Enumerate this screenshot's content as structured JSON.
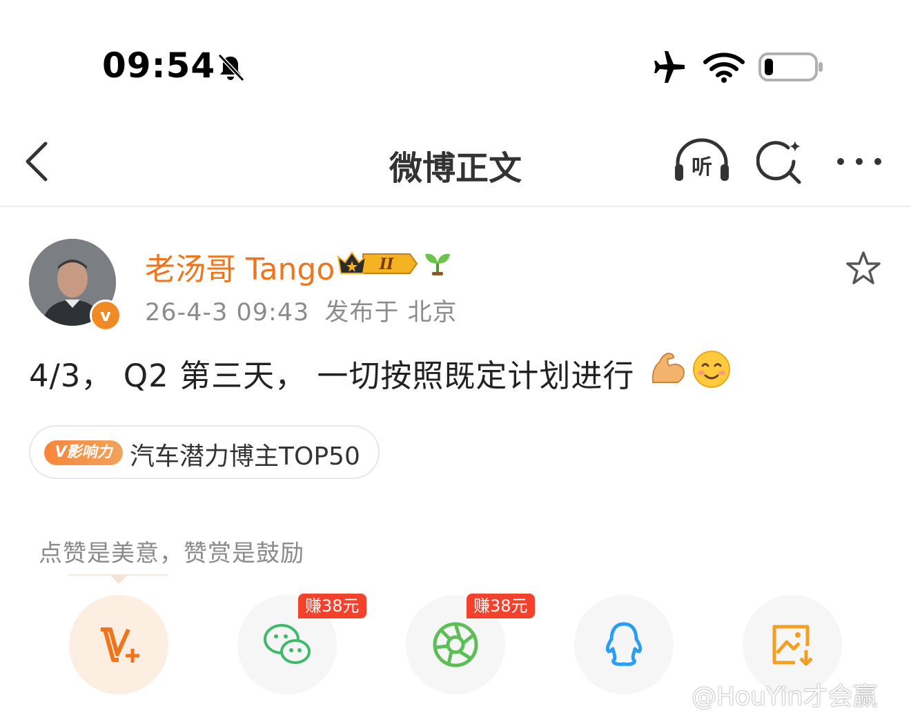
{
  "status_bar": {
    "time": "09:54"
  },
  "nav": {
    "title": "微博正文",
    "listen_label": "听"
  },
  "post": {
    "author": "老汤哥 Tango",
    "level_badge": "II",
    "verified_mark": "v",
    "timestamp": "26-4-3 09:43",
    "location": "发布于 北京",
    "content": "4/3， Q2 第三天， 一切按照既定计划进行"
  },
  "tag": {
    "badge": "V影响力",
    "text": "汽车潜力博主TOP50"
  },
  "reward_hint": "点赞是美意，赞赏是鼓励",
  "share": [
    {
      "icon": "v-plus-icon"
    },
    {
      "icon": "wechat-icon",
      "earn": "赚38元"
    },
    {
      "icon": "moments-icon",
      "earn": "赚38元"
    },
    {
      "icon": "qq-icon"
    },
    {
      "icon": "save-image-icon"
    }
  ],
  "watermark": "@HouYin才会赢",
  "colors": {
    "accent": "#f0741b",
    "earn_badge": "#f3412c",
    "wechat_green": "#3dbb6a",
    "qq_blue": "#2a9df4",
    "save_orange": "#f2a024"
  }
}
